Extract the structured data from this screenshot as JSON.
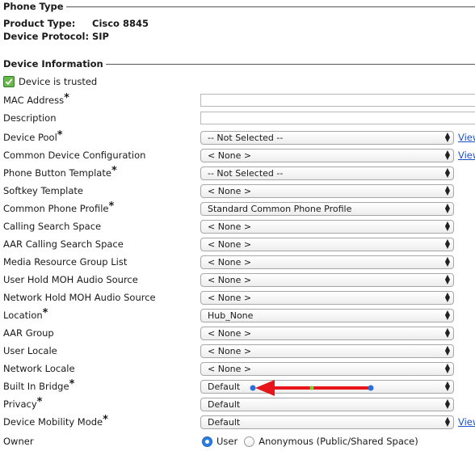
{
  "phone_type": {
    "heading": "Phone Type",
    "product_type_label": "Product Type:",
    "product_type_value": "Cisco 8845",
    "device_protocol_label": "Device Protocol:",
    "device_protocol_value": "SIP"
  },
  "device_info": {
    "heading": "Device Information",
    "trusted_text": "Device is trusted",
    "fields": {
      "mac_address": {
        "label": "MAC Address",
        "required": "*",
        "value": ""
      },
      "description": {
        "label": "Description",
        "value": ""
      },
      "device_pool": {
        "label": "Device Pool",
        "required": "*",
        "value": "-- Not Selected --",
        "link": "View"
      },
      "common_device_config": {
        "label": "Common Device Configuration",
        "value": "< None >",
        "link": "View"
      },
      "phone_button_template": {
        "label": "Phone Button Template",
        "required": "*",
        "value": "-- Not Selected --"
      },
      "softkey_template": {
        "label": "Softkey Template",
        "value": "< None >"
      },
      "common_phone_profile": {
        "label": "Common Phone Profile",
        "required": "*",
        "value": "Standard Common Phone Profile"
      },
      "calling_search_space": {
        "label": "Calling Search Space",
        "value": "< None >"
      },
      "aar_calling_search_space": {
        "label": "AAR Calling Search Space",
        "value": "< None >"
      },
      "media_resource_group_list": {
        "label": "Media Resource Group List",
        "value": "< None >"
      },
      "user_hold_moh": {
        "label": "User Hold MOH Audio Source",
        "value": "< None >"
      },
      "network_hold_moh": {
        "label": "Network Hold MOH Audio Source",
        "value": "< None >"
      },
      "location": {
        "label": "Location",
        "required": "*",
        "value": "Hub_None"
      },
      "aar_group": {
        "label": "AAR Group",
        "value": "< None >"
      },
      "user_locale": {
        "label": "User Locale",
        "value": "< None >"
      },
      "network_locale": {
        "label": "Network Locale",
        "value": "< None >"
      },
      "built_in_bridge": {
        "label": "Built In Bridge",
        "required": "*",
        "value": "Default"
      },
      "privacy": {
        "label": "Privacy",
        "required": "*",
        "value": "Default"
      },
      "device_mobility_mode": {
        "label": "Device Mobility Mode",
        "required": "*",
        "value": "Default",
        "link": "View"
      },
      "owner": {
        "label": "Owner",
        "option_user": "User",
        "option_anonymous": "Anonymous (Public/Shared Space)",
        "selected": "User"
      }
    }
  },
  "colors": {
    "annotation_arrow": "#e8141b",
    "annotation_handle": "#2a6fd6",
    "link": "#1a50c8",
    "check": "#69b84a"
  }
}
